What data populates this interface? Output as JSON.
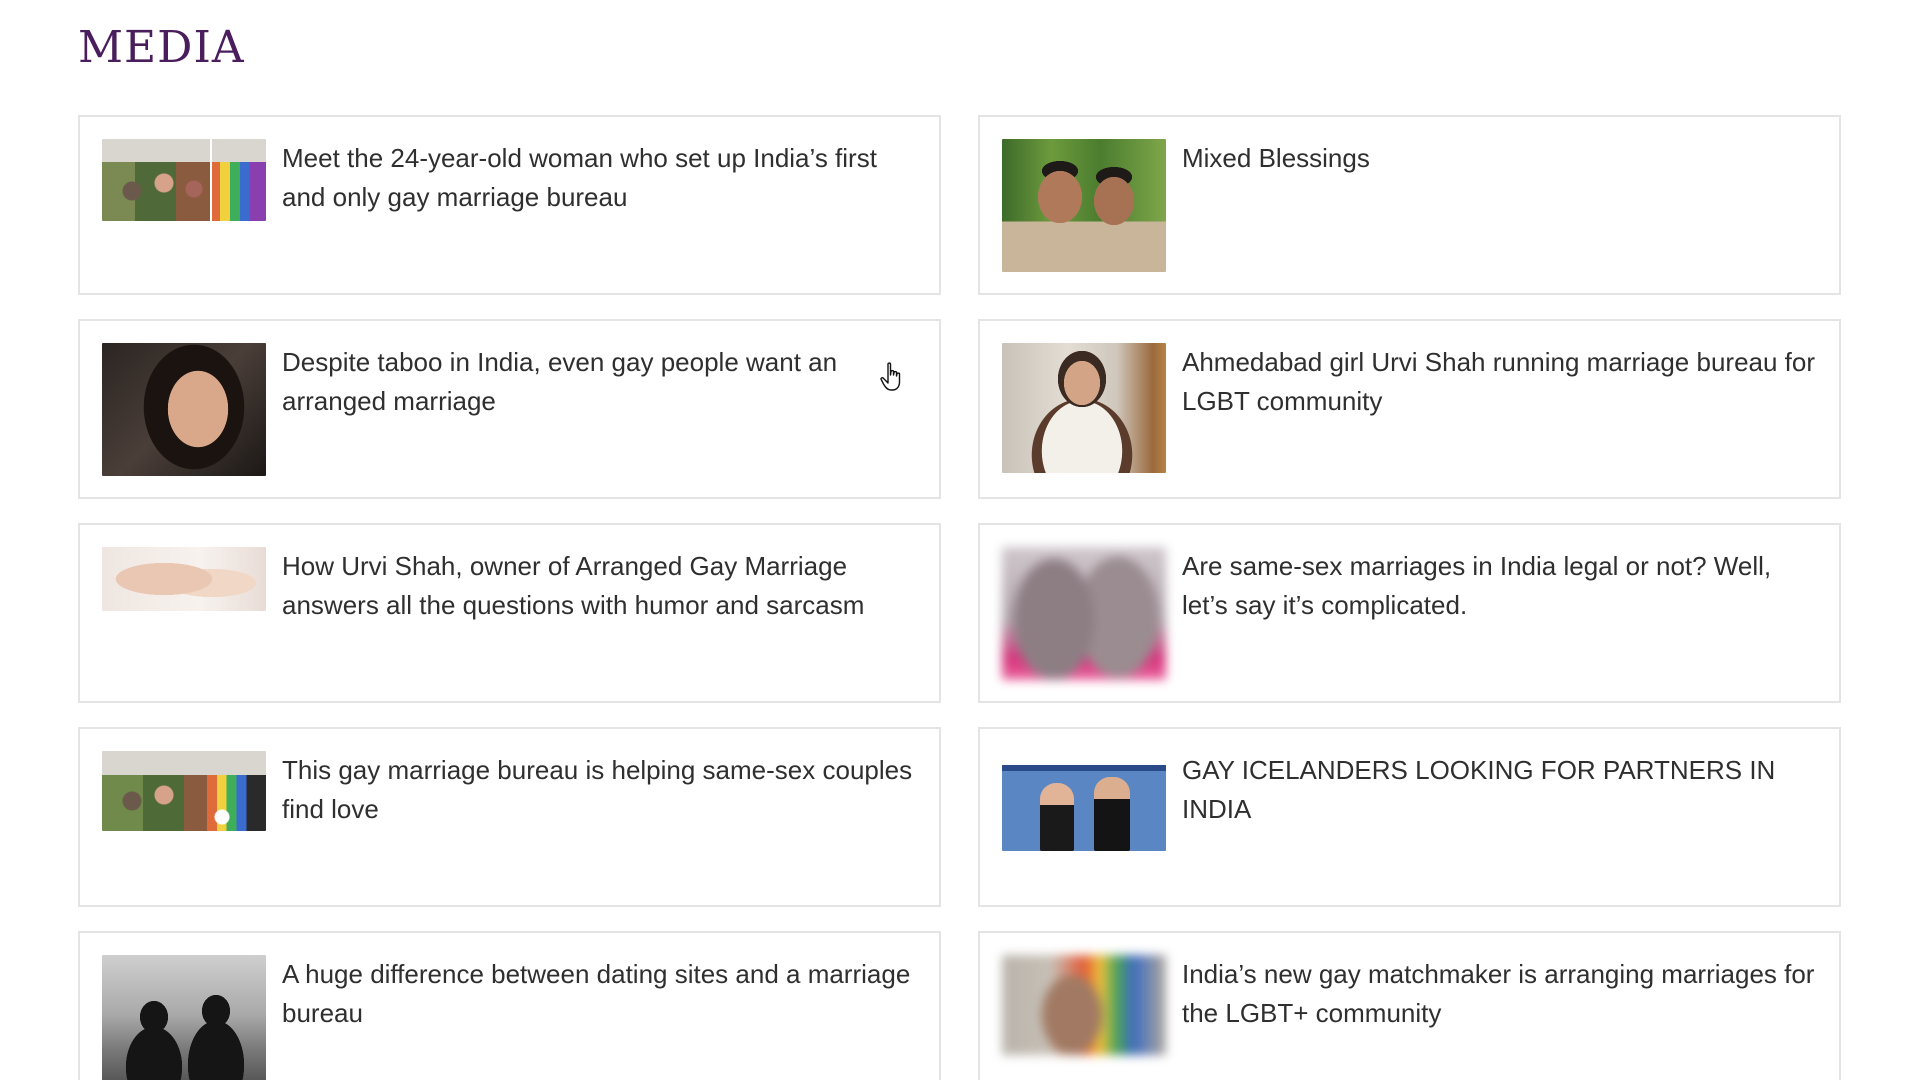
{
  "page": {
    "title": "MEDIA"
  },
  "articles": [
    {
      "title": "Meet the 24-year-old woman who set up India’s first and only gay marriage bureau",
      "thumbnail": "protest-march-photo"
    },
    {
      "title": "Mixed Blessings",
      "thumbnail": "two-men-smiling-photo"
    },
    {
      "title": "Despite taboo in India, even gay people want an arranged marriage",
      "thumbnail": "woman-portrait-photo"
    },
    {
      "title": "Ahmedabad girl Urvi Shah running marriage bureau for LGBT community",
      "thumbnail": "woman-standing-photo"
    },
    {
      "title": "How Urvi Shah, owner of Arranged Gay Marriage answers all the questions with humor and sarcasm",
      "thumbnail": "holding-hands-photo"
    },
    {
      "title": "Are same-sex marriages in India legal or not? Well, let’s say it’s complicated.",
      "thumbnail": "blurred-couple-photo"
    },
    {
      "title": "This gay marriage bureau is helping same-sex couples find love",
      "thumbnail": "protest-march-photo"
    },
    {
      "title": "GAY ICELANDERS LOOKING FOR PARTNERS IN INDIA",
      "thumbnail": "website-screenshot"
    },
    {
      "title": "A huge difference between dating sites and a marriage bureau",
      "thumbnail": "couple-silhouette-photo"
    },
    {
      "title": "India’s new gay matchmaker is arranging marriages for the LGBT+ community",
      "thumbnail": "blurred-celebration-photo"
    }
  ],
  "colors": {
    "heading": "#4a1d5c",
    "card_border": "#e4e4e4",
    "text": "#2f2f2f"
  }
}
